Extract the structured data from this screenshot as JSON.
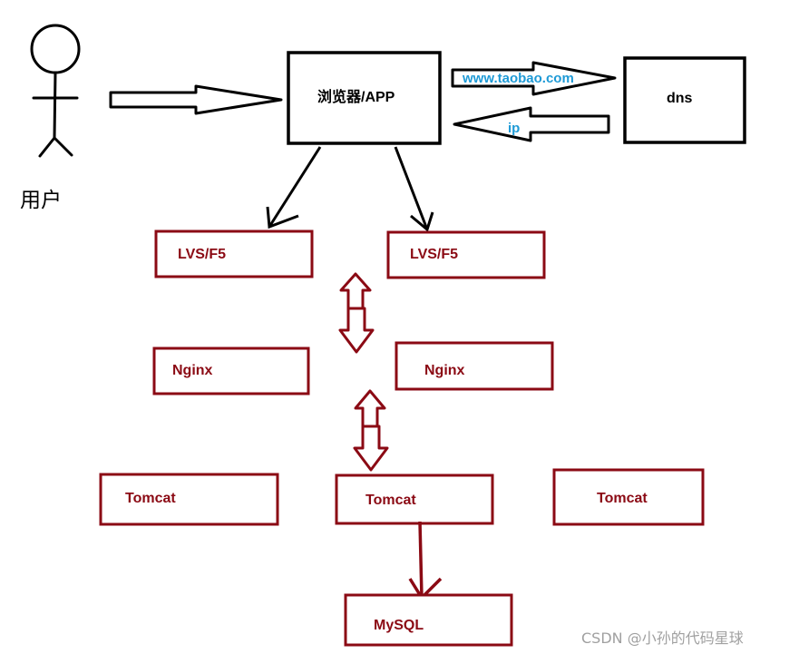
{
  "user": {
    "label": "用户"
  },
  "browser": {
    "label": "浏览器/APP"
  },
  "dns": {
    "label": "dns",
    "request_label": "www.taobao.com",
    "response_label": "ip"
  },
  "lvs": [
    {
      "label": "LVS/F5"
    },
    {
      "label": "LVS/F5"
    }
  ],
  "nginx": [
    {
      "label": "Nginx"
    },
    {
      "label": "Nginx"
    }
  ],
  "tomcat": [
    {
      "label": "Tomcat"
    },
    {
      "label": "Tomcat"
    },
    {
      "label": "Tomcat"
    }
  ],
  "mysql": {
    "label": "MySQL"
  },
  "watermark": "CSDN @小孙的代码星球",
  "colors": {
    "server_stroke": "#8b0a14",
    "client_stroke": "#000000",
    "link_text": "#1e9ad6"
  }
}
